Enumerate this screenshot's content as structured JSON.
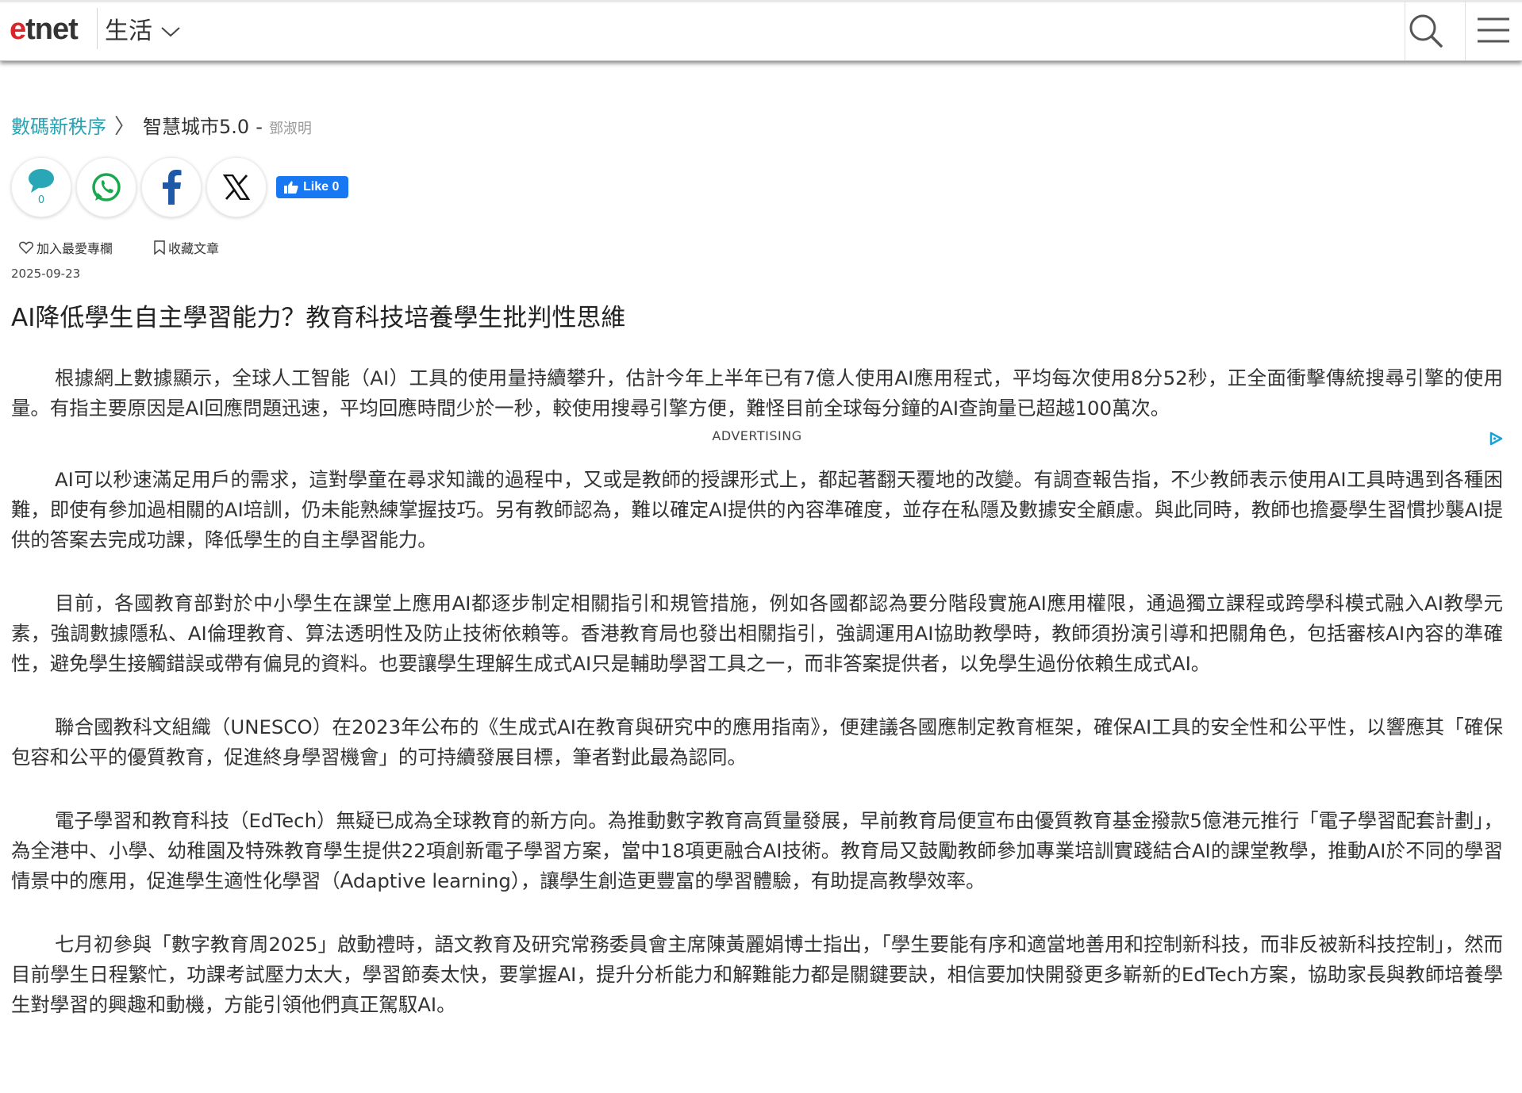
{
  "header": {
    "logo_e": "e",
    "logo_rest": "tnet",
    "section": "生活"
  },
  "breadcrumb": {
    "root": "數碼新秩序",
    "separator": "〉",
    "column": "智慧城市5.0",
    "dash": "-",
    "author": "鄧淑明"
  },
  "share": {
    "comment_count": "0",
    "fb_like_label": "Like 0"
  },
  "actions": {
    "favorite_column": "加入最愛專欄",
    "bookmark_article": "收藏文章"
  },
  "article": {
    "date": "2025-09-23",
    "title": "AI降低學生自主學習能力？教育科技培養學生批判性思維",
    "advertising_label": "ADVERTISING",
    "paragraphs": [
      "根據網上數據顯示，全球人工智能（AI）工具的使用量持續攀升，估計今年上半年已有7億人使用AI應用程式，平均每次使用8分52秒，正全面衝擊傳統搜尋引擎的使用量。有指主要原因是AI回應問題迅速，平均回應時間少於一秒，較使用搜尋引擎方便，難怪目前全球每分鐘的AI查詢量已超越100萬次。",
      "AI可以秒速滿足用戶的需求，這對學童在尋求知識的過程中，又或是教師的授課形式上，都起著翻天覆地的改變。有調查報告指，不少教師表示使用AI工具時遇到各種困難，即使有參加過相關的AI培訓，仍未能熟練掌握技巧。另有教師認為，難以確定AI提供的內容準確度，並存在私隱及數據安全顧慮。與此同時，教師也擔憂學生習慣抄襲AI提供的答案去完成功課，降低學生的自主學習能力。",
      "目前，各國教育部對於中小學生在課堂上應用AI都逐步制定相關指引和規管措施，例如各國都認為要分階段實施AI應用權限，通過獨立課程或跨學科模式融入AI教學元素，強調數據隱私、AI倫理教育、算法透明性及防止技術依賴等。香港教育局也發出相關指引，強調運用AI協助教學時，教師須扮演引導和把關角色，包括審核AI內容的準確性，避免學生接觸錯誤或帶有偏見的資料。也要讓學生理解生成式AI只是輔助學習工具之一，而非答案提供者，以免學生過份依賴生成式AI。",
      "聯合國教科文組織（UNESCO）在2023年公布的《生成式AI在教育與研究中的應用指南》，便建議各國應制定教育框架，確保AI工具的安全性和公平性，以響應其「確保包容和公平的優質教育，促進終身學習機會」的可持續發展目標，筆者對此最為認同。",
      "電子學習和教育科技（EdTech）無疑已成為全球教育的新方向。為推動數字教育高質量發展，早前教育局便宣布由優質教育基金撥款5億港元推行「電子學習配套計劃」，為全港中、小學、幼稚園及特殊教育學生提供22項創新電子學習方案，當中18項更融合AI技術。教育局又鼓勵教師參加專業培訓實踐結合AI的課堂教學，推動AI於不同的學習情景中的應用，促進學生適性化學習（Adaptive learning），讓學生創造更豐富的學習體驗，有助提高教學效率。",
      "七月初參與「數字教育周2025」啟動禮時，語文教育及研究常務委員會主席陳黃麗娟博士指出，「學生要能有序和適當地善用和控制新科技，而非反被新科技控制」，然而目前學生日程繁忙，功課考試壓力太大，學習節奏太快，要掌握AI，提升分析能力和解難能力都是關鍵要訣，相信要加快開發更多嶄新的EdTech方案，協助家長與教師培養學生對學習的興趣和動機，方能引領他們真正駕馭AI。"
    ]
  }
}
